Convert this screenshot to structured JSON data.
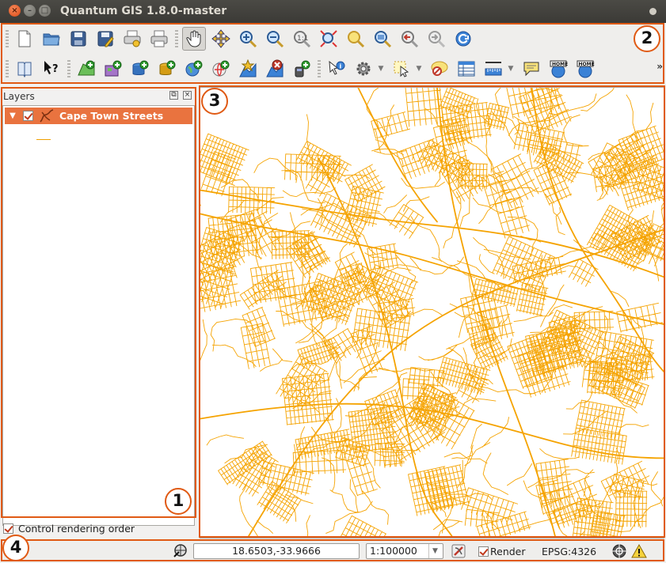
{
  "window": {
    "title": "Quantum GIS 1.8.0-master",
    "close_symbol": "×",
    "minimize_symbol": "–",
    "maximize_symbol": "□"
  },
  "toolbar": {
    "row1_icons": [
      "new-project-icon",
      "open-project-icon",
      "save-project-icon",
      "save-as-icon",
      "print-composer-icon",
      "print-icon",
      "pan-hand-icon",
      "pan-to-selection-icon",
      "zoom-in-icon",
      "zoom-out-icon",
      "zoom-actual-icon",
      "zoom-full-icon",
      "zoom-selection-icon",
      "zoom-layer-icon",
      "zoom-last-icon",
      "zoom-next-icon",
      "refresh-icon"
    ],
    "row2_icons": [
      "whats-this-icon",
      "help-icon",
      "add-vector-icon",
      "add-raster-icon",
      "add-postgis-icon",
      "add-spatialite-icon",
      "add-wms-icon",
      "new-shapefile-icon",
      "remove-layer-icon",
      "add-wfs-icon",
      "identify-icon",
      "action-gear-icon",
      "select-icon",
      "deselect-icon",
      "attribute-table-icon",
      "measure-icon",
      "map-tips-icon",
      "new-bookmark-icon",
      "show-bookmarks-icon"
    ],
    "overflow": "»"
  },
  "callouts": [
    "1",
    "2",
    "3",
    "4"
  ],
  "layers_panel": {
    "title": "Layers",
    "float_symbol": "⧉",
    "close_symbol": "×",
    "expander": "▼",
    "layers": [
      {
        "name": "Cape Town Streets",
        "visible": true,
        "selected": true,
        "symbol_color": "#f0a000"
      }
    ],
    "control_rendering_order_label": "Control rendering order",
    "control_rendering_order_checked": true
  },
  "map": {
    "line_color": "#f5a300",
    "background": "#ffffff"
  },
  "status_bar": {
    "coordinates": "18.6503,-33.9666",
    "scale": "1:100000",
    "scale_arrow": "▼",
    "render_label": "Render",
    "render_checked": true,
    "crs": "EPSG:4326"
  },
  "colors": {
    "accent": "#e05a14",
    "selection": "#e9733f",
    "titlebar": "#3c3b37"
  }
}
